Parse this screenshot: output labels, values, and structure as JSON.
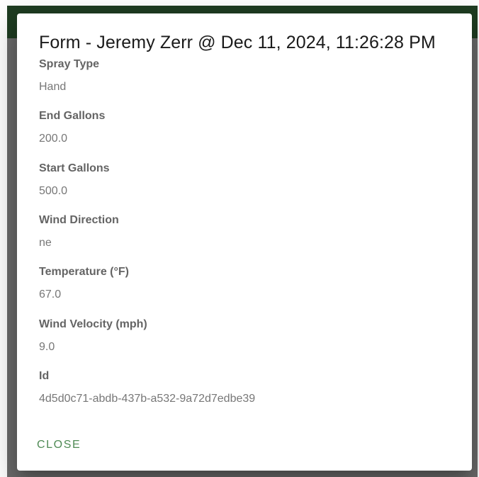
{
  "dialog": {
    "title": "Form - Jeremy Zerr @ Dec 11, 2024, 11:26:28 PM",
    "fields": [
      {
        "label": "Spray Type",
        "value": "Hand"
      },
      {
        "label": "End Gallons",
        "value": "200.0"
      },
      {
        "label": "Start Gallons",
        "value": "500.0"
      },
      {
        "label": "Wind Direction",
        "value": "ne"
      },
      {
        "label": "Temperature (°F)",
        "value": "67.0"
      },
      {
        "label": "Wind Velocity (mph)",
        "value": "9.0"
      },
      {
        "label": "Id",
        "value": "4d5d0c71-abdb-437b-a532-9a72d7edbe39"
      }
    ],
    "close_label": "CLOSE"
  },
  "colors": {
    "backdrop": "#6b6b6b",
    "appbar": "#1f3d22",
    "accent": "#4f8a55"
  }
}
